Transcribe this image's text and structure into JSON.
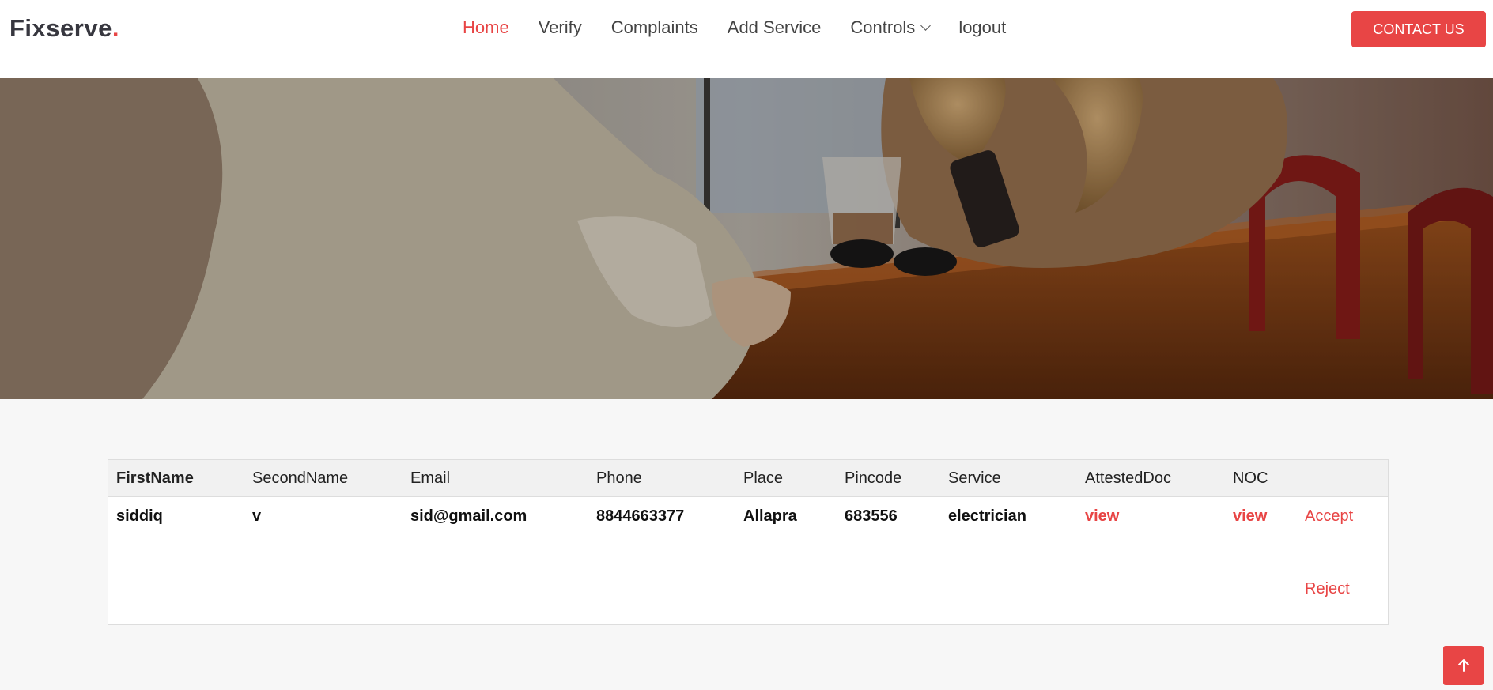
{
  "brand": {
    "name": "Fixserve",
    "dot": ".",
    "accent": "#e84545"
  },
  "nav": {
    "home": "Home",
    "verify": "Verify",
    "complaints": "Complaints",
    "add_service": "Add Service",
    "controls": "Controls",
    "logout": "logout"
  },
  "contact_label": "CONTACT US",
  "table": {
    "headers": [
      "FirstName",
      "SecondName",
      "Email",
      "Phone",
      "Place",
      "Pincode",
      "Service",
      "AttestedDoc",
      "NOC"
    ],
    "row": {
      "first_name": "siddiq",
      "second_name": "v",
      "email": "sid@gmail.com",
      "phone": "8844663377",
      "place": "Allapra",
      "pincode": "683556",
      "service": "electrician",
      "attested_doc": "view",
      "noc": "view",
      "accept": "Accept",
      "reject": "Reject"
    }
  },
  "icons": {
    "scroll_top": "arrow-up-icon",
    "controls": "chevron-down-icon"
  }
}
